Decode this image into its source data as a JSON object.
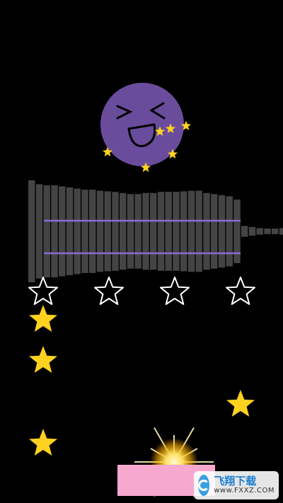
{
  "game": {
    "boss_face": {
      "color": "#6a4c9c",
      "expression": "laughing-squint-eyes"
    },
    "equalizer": {
      "bar_color": "#444444",
      "track_line_color": "#8a6ad6",
      "levels": [
        0.93,
        0.86,
        0.84,
        0.84,
        0.82,
        0.8,
        0.78,
        0.76,
        0.76,
        0.74,
        0.73,
        0.72,
        0.7,
        0.68,
        0.68,
        0.7,
        0.7,
        0.72,
        0.72,
        0.72,
        0.73,
        0.74,
        0.74,
        0.7,
        0.68,
        0.66,
        0.64,
        0.58,
        0.1,
        0.08,
        0.06,
        0.05,
        0.05,
        0.06
      ]
    },
    "target_lanes": 4,
    "lane_star_icon": "outline-star-icon",
    "collectible_star_icon": "gold-star-icon",
    "accent_gold": "#ffd21f",
    "player": {
      "pad_color": "#f7a8cf",
      "effect": "burst-flash"
    }
  },
  "watermark": {
    "title": "飞翔下载",
    "url": "www.FXXZ.COM"
  }
}
